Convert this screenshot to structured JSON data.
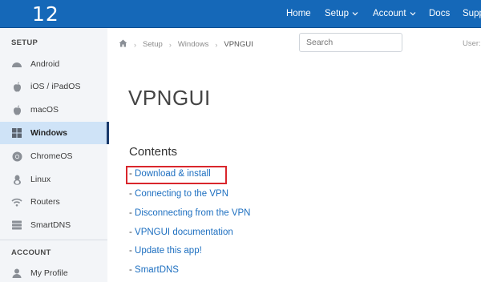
{
  "header": {
    "logo": "12",
    "nav": {
      "home": "Home",
      "setup": "Setup",
      "account": "Account",
      "docs": "Docs",
      "support": "Supp"
    }
  },
  "sidebar": {
    "setup_heading": "SETUP",
    "items": [
      {
        "label": "Android",
        "icon": "android-icon"
      },
      {
        "label": "iOS / iPadOS",
        "icon": "apple-icon"
      },
      {
        "label": "macOS",
        "icon": "apple-icon"
      },
      {
        "label": "Windows",
        "icon": "windows-icon"
      },
      {
        "label": "ChromeOS",
        "icon": "chrome-icon"
      },
      {
        "label": "Linux",
        "icon": "linux-icon"
      },
      {
        "label": "Routers",
        "icon": "wifi-icon"
      },
      {
        "label": "SmartDNS",
        "icon": "server-icon"
      }
    ],
    "account_heading": "ACCOUNT",
    "account_items": [
      {
        "label": "My Profile",
        "icon": "user-icon"
      }
    ]
  },
  "breadcrumb": {
    "setup": "Setup",
    "windows": "Windows",
    "current": "VPNGUI"
  },
  "search": {
    "placeholder": "Search"
  },
  "user_label": "User:",
  "main": {
    "title": "VPNGUI",
    "contents_heading": "Contents",
    "toc": [
      {
        "dash": "- ",
        "label": "Download & install"
      },
      {
        "dash": "- ",
        "label": "Connecting to the VPN"
      },
      {
        "dash": "- ",
        "label": "Disconnecting from the VPN"
      },
      {
        "dash": "- ",
        "label": "VPNGUI documentation"
      },
      {
        "dash": "- ",
        "label": "Update this app!"
      },
      {
        "dash": "- ",
        "label": "SmartDNS"
      }
    ]
  },
  "colors": {
    "header": "#1568b8",
    "link": "#1d6fc0",
    "active_item": "#cfe3f7",
    "highlight": "#d9262c"
  }
}
